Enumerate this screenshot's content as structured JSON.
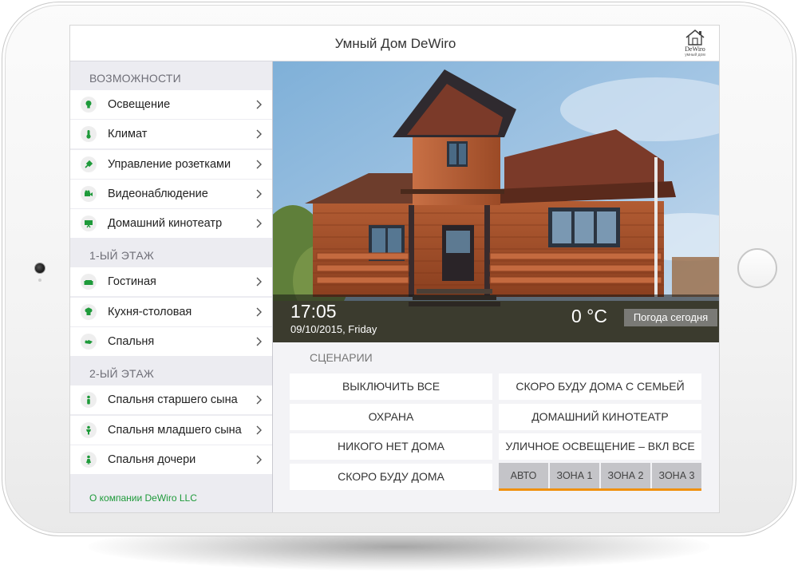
{
  "app": {
    "title": "Умный Дом DeWiro"
  },
  "logo": {
    "name": "DeWiro",
    "subtitle": "умный дом",
    "icon": "house-logo-icon"
  },
  "sidebar": {
    "sections": [
      {
        "header": "ВОЗМОЖНОСТИ",
        "items": [
          {
            "label": "Освещение",
            "icon": "lightbulb-icon"
          },
          {
            "label": "Климат",
            "icon": "thermometer-icon"
          },
          {
            "label": "Управление розетками",
            "icon": "plug-icon"
          },
          {
            "label": "Видеонаблюдение",
            "icon": "camera-icon"
          },
          {
            "label": "Домашний кинотеатр",
            "icon": "screen-icon"
          }
        ]
      },
      {
        "header": "1-ЫЙ ЭТАЖ",
        "items": [
          {
            "label": "Гостиная",
            "icon": "sofa-icon"
          },
          {
            "label": "Кухня-столовая",
            "icon": "chef-hat-icon"
          },
          {
            "label": "Спальня",
            "icon": "bed-icon"
          }
        ]
      },
      {
        "header": "2-ЫЙ ЭТАЖ",
        "items": [
          {
            "label": "Спальня старшего сына",
            "icon": "person-icon"
          },
          {
            "label": "Спальня младшего сына",
            "icon": "child-icon"
          },
          {
            "label": "Спальня дочери",
            "icon": "girl-icon"
          }
        ]
      }
    ],
    "footer_link": "О компании DeWiro LLC"
  },
  "status": {
    "time": "17:05",
    "date": "09/10/2015, Friday",
    "temperature": "0 °C",
    "weather_button": "Погода сегодня"
  },
  "scenarios": {
    "title": "СЦЕНАРИИ",
    "left": [
      "ВЫКЛЮЧИТЬ ВСЕ",
      "ОХРАНА",
      "НИКОГО НЕТ ДОМА",
      "СКОРО БУДУ ДОМА"
    ],
    "right": [
      "СКОРО БУДУ ДОМА С СЕМЬЕЙ",
      "ДОМАШНИЙ КИНОТЕАТР",
      "УЛИЧНОЕ ОСВЕЩЕНИЕ – ВКЛ ВСЕ"
    ],
    "zones": [
      "АВТО",
      "ЗОНА 1",
      "ЗОНА 2",
      "ЗОНА 3"
    ]
  },
  "colors": {
    "accent_green": "#1e9a3a",
    "zone_underline": "#f0900e",
    "sidebar_bg": "#ececf1"
  }
}
